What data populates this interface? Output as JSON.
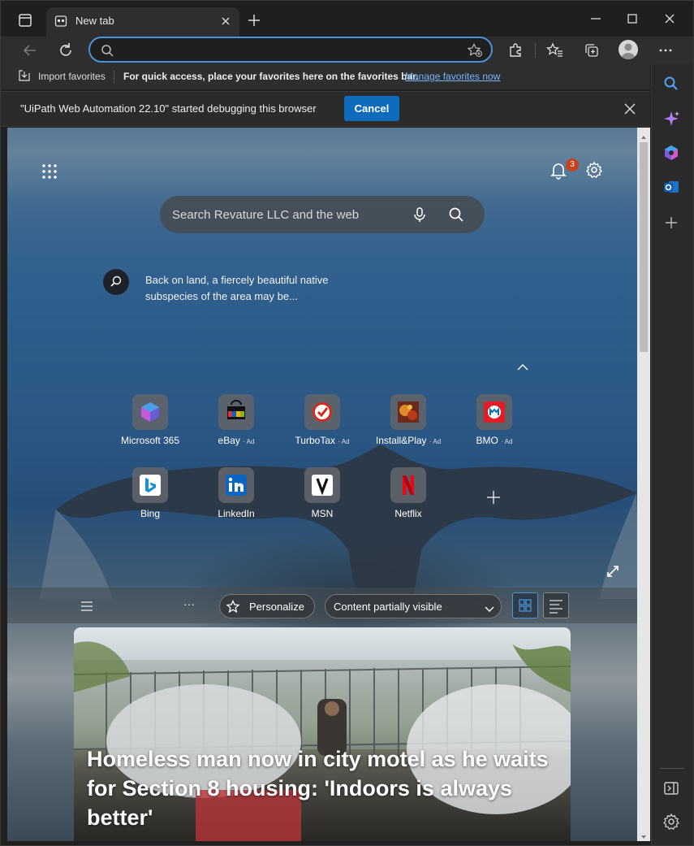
{
  "browser": {
    "tab": {
      "title": "New tab"
    },
    "address_bar": {
      "value": "",
      "placeholder": ""
    }
  },
  "favorites_bar": {
    "import_label": "Import favorites",
    "message": "For quick access, place your favorites here on the favorites bar.",
    "manage_link": "Manage favorites now"
  },
  "infobar": {
    "message": "\"UiPath Web Automation 22.10\" started debugging this browser",
    "cancel_label": "Cancel"
  },
  "newtab": {
    "notifications_count": "3",
    "search_placeholder": "Search Revature LLC and the web",
    "fact_line1": "Back on land, a fiercely beautiful native",
    "fact_line2": "subspecies of the area may be...",
    "tiles": [
      {
        "label": "Microsoft 365",
        "ad": "",
        "icon": "microsoft-365-icon"
      },
      {
        "label": "eBay",
        "ad": "· Ad",
        "icon": "ebay-icon"
      },
      {
        "label": "TurboTax",
        "ad": "· Ad",
        "icon": "turbotax-icon"
      },
      {
        "label": "Install&Play",
        "ad": "· Ad",
        "icon": "install-play-icon"
      },
      {
        "label": "BMO",
        "ad": "· Ad",
        "icon": "bmo-icon"
      },
      {
        "label": "Bing",
        "ad": "",
        "icon": "bing-icon"
      },
      {
        "label": "LinkedIn",
        "ad": "",
        "icon": "linkedin-icon"
      },
      {
        "label": "MSN",
        "ad": "",
        "icon": "msn-icon"
      },
      {
        "label": "Netflix",
        "ad": "",
        "icon": "netflix-icon"
      }
    ],
    "feed": {
      "ellipsis": "···",
      "personalize_label": "Personalize",
      "visibility_label": "Content partially visible"
    },
    "news": {
      "headline": "Homeless man now in city motel as he waits for Section 8 housing: 'Indoors is always better'"
    }
  },
  "colors": {
    "accent": "#4a93d6",
    "cancel_button": "#0f6cbd",
    "badge": "#c8411f",
    "link": "#7ab5ff"
  }
}
